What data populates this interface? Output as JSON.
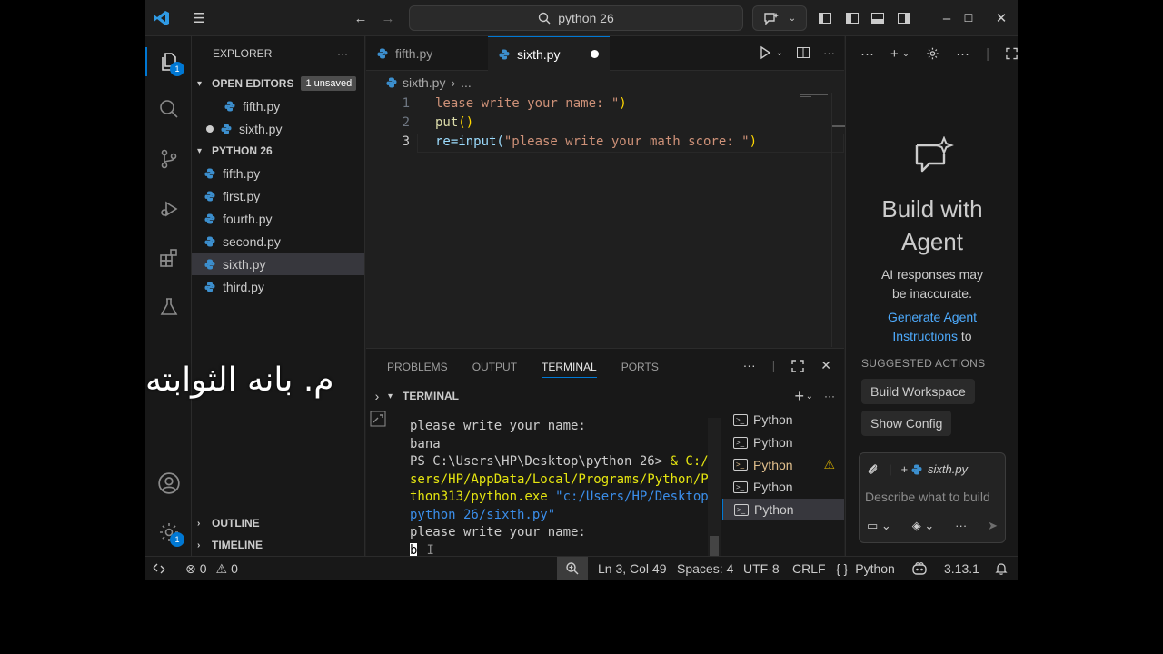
{
  "titlebar": {
    "search_text": "python 26"
  },
  "activity": {
    "explorer_badge": "1",
    "settings_badge": "1"
  },
  "sidebar": {
    "title": "EXPLORER",
    "open_editors": {
      "title": "OPEN EDITORS",
      "badge": "1 unsaved",
      "items": [
        "fifth.py",
        "sixth.py"
      ]
    },
    "folder": {
      "title": "PYTHON 26",
      "items": [
        "fifth.py",
        "first.py",
        "fourth.py",
        "second.py",
        "sixth.py",
        "third.py"
      ],
      "selected": "sixth.py"
    },
    "outline": "OUTLINE",
    "timeline": "TIMELINE"
  },
  "editor": {
    "tabs": [
      {
        "label": "fifth.py",
        "active": false
      },
      {
        "label": "sixth.py",
        "active": true,
        "dirty": true
      }
    ],
    "breadcrumb": [
      "sixth.py",
      "..."
    ],
    "lines": [
      {
        "num": "1",
        "before": "",
        "str": "lease write your name: \"",
        "after": ")"
      },
      {
        "num": "2",
        "before": "put",
        "str": "",
        "after": "()"
      },
      {
        "num": "3",
        "before": "re=input(",
        "str": "\"please write your math score: \"",
        "after": ")"
      }
    ]
  },
  "panel": {
    "tabs": [
      "PROBLEMS",
      "OUTPUT",
      "TERMINAL",
      "PORTS"
    ],
    "active_tab": "TERMINAL",
    "terminal_header": "TERMINAL",
    "terminal_lines": {
      "l1": "please write your name:",
      "l2": "bana",
      "l3_prompt": "PS C:\\Users\\HP\\Desktop\\python 26> ",
      "l3_cmd": "& C:/U",
      "l4": "sers/HP/AppData/Local/Programs/Python/Py",
      "l5_a": "thon313/python.exe ",
      "l5_b": "\"c:/Users/HP/Desktop/",
      "l6": "python 26/sixth.py\"",
      "l7": "please write your name:",
      "l8": "b"
    },
    "terminal_instances": [
      "Python",
      "Python",
      "Python",
      "Python",
      "Python"
    ]
  },
  "chat": {
    "title_line1": "Build with",
    "title_line2": "Agent",
    "note_line1": "AI responses may",
    "note_line2": "be inaccurate.",
    "link_line1": "Generate Agent",
    "link_line2": "Instructions",
    "link_suffix": " to",
    "suggested": "SUGGESTED ACTIONS",
    "actions": [
      "Build Workspace",
      "Show Config"
    ],
    "context_file": "sixth.py",
    "input_placeholder": "Describe what to build"
  },
  "status": {
    "errors": "0",
    "warnings": "0",
    "position": "Ln 3, Col 49",
    "spaces": "Spaces: 4",
    "encoding": "UTF-8",
    "eol": "CRLF",
    "language": "Python",
    "language_prefix": "{ }",
    "version": "3.13.1"
  },
  "overlay": {
    "text": "م. بانه الثوابته"
  },
  "colors": {
    "accent": "#0078d4",
    "string": "#ce9178",
    "function": "#dcdcaa",
    "link": "#4daafc"
  }
}
